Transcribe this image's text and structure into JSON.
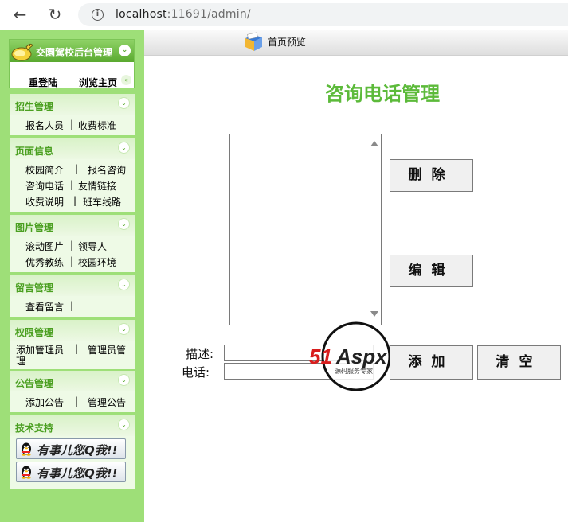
{
  "browser": {
    "url_host": "localhost",
    "url_rest": ":11691/admin/"
  },
  "sidebar": {
    "logo_title": "交園駕校后台管理",
    "relogin": "重登陆",
    "home": "浏览主页",
    "groups": [
      {
        "title": "招生管理",
        "rows": [
          [
            "报名人员",
            "|",
            "收费标准"
          ]
        ]
      },
      {
        "title": "页面信息",
        "rows": [
          [
            "校园简介",
            "|",
            "报名咨询"
          ],
          [
            "咨询电话",
            "|",
            "友情链接"
          ],
          [
            "收费说明",
            "|",
            "班车线路"
          ]
        ]
      },
      {
        "title": "图片管理",
        "rows": [
          [
            "滚动图片",
            "|",
            "领导人"
          ],
          [
            "优秀教练",
            "|",
            "校园环境"
          ]
        ]
      },
      {
        "title": "留言管理",
        "rows": [
          [
            "查看留言",
            "|",
            ""
          ]
        ]
      },
      {
        "title": "权限管理",
        "rows": [
          [
            "添加管理员",
            "|",
            "管理员管"
          ],
          [
            "理",
            "",
            ""
          ]
        ]
      },
      {
        "title": "公告管理",
        "rows": [
          [
            "添加公告",
            "|",
            "管理公告"
          ]
        ]
      },
      {
        "title": "技术支持",
        "rows": []
      }
    ],
    "qq_label": "有事儿您Q我!!"
  },
  "header": {
    "preview_label": "首页预览"
  },
  "main": {
    "title": "咨询电话管理",
    "delete_label": "删除",
    "edit_label": "编辑",
    "add_label": "添加",
    "clear_label": "清空",
    "desc_label": "描述:",
    "phone_label": "电话:",
    "desc_value": "",
    "phone_value": ""
  },
  "watermark": {
    "brand": "51Aspx",
    "tagline": "源码服务专家"
  },
  "colors": {
    "sidebar_bg": "#9edf78",
    "accent_green": "#5cba3a",
    "menu_title": "#4a9f20"
  }
}
